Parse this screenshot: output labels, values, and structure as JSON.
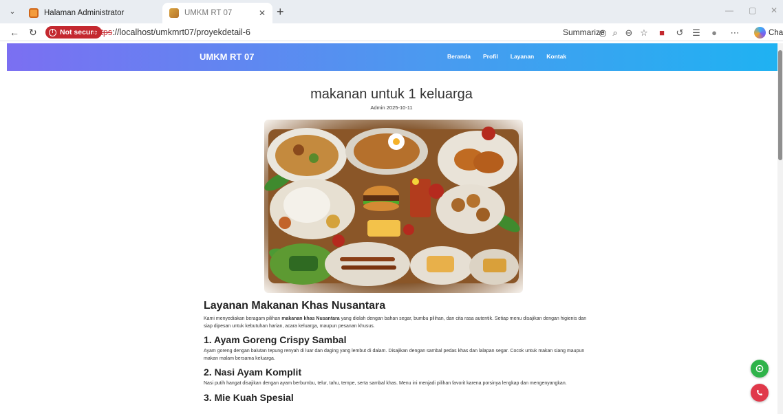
{
  "browser": {
    "tabs": [
      {
        "title": "Halaman Administrator",
        "active": false
      },
      {
        "title": "UMKM RT 07",
        "active": true
      }
    ],
    "security_label": "Not secure",
    "url_protocol": "https",
    "url_rest": "://localhost/umkmrt07/proyekdetail-6",
    "summarize_label": "Summarize",
    "chat_label": "Chat",
    "colors": {
      "insecure": "#c4282f"
    }
  },
  "site": {
    "brand": "UMKM RT 07",
    "menu": [
      "Beranda",
      "Profil",
      "Layanan",
      "Kontak"
    ],
    "colors": {
      "gradient_start": "#7b6ff2",
      "gradient_end": "#1fb2f2"
    }
  },
  "post": {
    "title": "makanan untuk 1 keluarga",
    "meta": "Admin 2025-10-11",
    "image_alt": "Aneka makanan khas Nusantara",
    "heading": "Layanan Makanan Khas Nusantara",
    "intro_before": "Kami menyediakan beragam pilihan ",
    "intro_bold": "makanan khas Nusantara",
    "intro_after": " yang diolah dengan bahan segar, bumbu pilihan, dan cita rasa autentik. Setiap menu disajikan dengan higienis dan siap dipesan untuk kebutuhan harian, acara keluarga, maupun pesanan khusus.",
    "items": [
      {
        "title": "1. Ayam Goreng Crispy Sambal",
        "desc": "Ayam goreng dengan balutan tepung renyah di luar dan daging yang lembut di dalam. Disajikan dengan sambal pedas khas dan lalapan segar. Cocok untuk makan siang maupun makan malam bersama keluarga."
      },
      {
        "title": "2. Nasi Ayam Komplit",
        "desc": "Nasi putih hangat disajikan dengan ayam berbumbu, telur, tahu, tempe, serta sambal khas. Menu ini menjadi pilihan favorit karena porsinya lengkap dan mengenyangkan."
      },
      {
        "title": "3. Mie Kuah Spesial",
        "desc": ""
      }
    ]
  },
  "floating": {
    "whatsapp_icon": "whatsapp-icon",
    "phone_icon": "phone-icon"
  }
}
